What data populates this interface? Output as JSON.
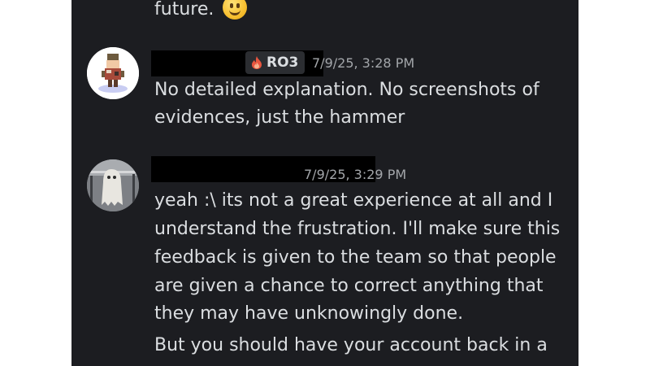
{
  "top_message": {
    "text": "future.",
    "emoji": "slightly-smiling-face-emoji"
  },
  "messages": [
    {
      "author_redacted": true,
      "badge": {
        "icon": "flame-icon",
        "label": "RO3"
      },
      "timestamp": "7/9/25, 3:28 PM",
      "lines": [
        "No detailed explanation. No screenshots of",
        "evidences, just the hammer"
      ]
    },
    {
      "author_redacted": true,
      "timestamp": "7/9/25, 3:29 PM",
      "lines": [
        "yeah :\\ its not a great experience at all and I",
        "understand the frustration. I'll make sure this",
        "feedback is given to the team so that people",
        "are given a chance to correct anything that",
        "they may have unknowingly done."
      ],
      "followup_lines": [
        "But you should have your account back in a"
      ]
    }
  ],
  "colors": {
    "background": "#1c1d21",
    "text": "#dbdee1",
    "timestamp": "#a3a6aa",
    "badge_background": "#2b2d31",
    "redaction": "#000000"
  }
}
